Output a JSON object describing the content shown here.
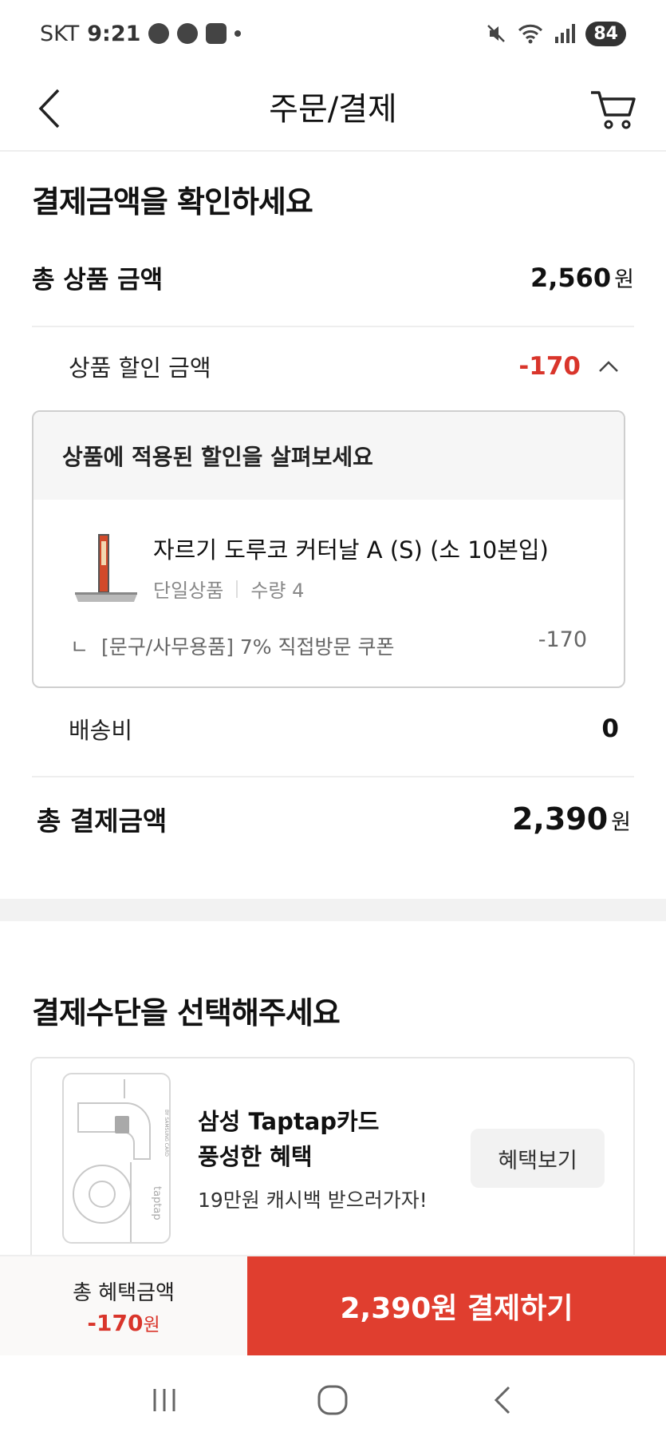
{
  "status_bar": {
    "carrier": "SKT",
    "time": "9:21",
    "battery": "84"
  },
  "header": {
    "title": "주문/결제"
  },
  "payment_summary": {
    "heading": "결제금액을 확인하세요",
    "total_product_label": "총 상품 금액",
    "total_product_amount": "2,560",
    "won": "원",
    "discount_label": "상품 할인 금액",
    "discount_amount": "-170",
    "discount_box": {
      "heading": "상품에 적용된 할인을 살펴보세요",
      "product_name": "자르기 도루코 커터날 A (S) (소 10본입)",
      "product_type": "단일상품",
      "quantity": "수량 4",
      "coupon_prefix": "ㄴ",
      "coupon_name": "[문구/사무용품] 7% 직접방문 쿠폰",
      "coupon_amount": "-170"
    },
    "shipping_label": "배송비",
    "shipping_amount": "0",
    "grand_total_label": "총 결제금액",
    "grand_total_amount": "2,390"
  },
  "payment_method": {
    "heading": "결제수단을 선택해주세요",
    "card_title": "삼성 Taptap카드",
    "card_subtitle": "풍성한 혜택",
    "card_desc": "19만원 캐시백 받으러가자!",
    "benefit_button": "혜택보기",
    "card_brand_text": "taptap",
    "card_issuer_text": "BY SAMSUNG CARD"
  },
  "bottom_bar": {
    "benefit_label": "총 혜택금액",
    "benefit_amount": "-170",
    "benefit_won": "원",
    "pay_button": "2,390원 결제하기"
  },
  "colors": {
    "accent_red": "#e03e2f",
    "discount_red": "#d9352b"
  }
}
